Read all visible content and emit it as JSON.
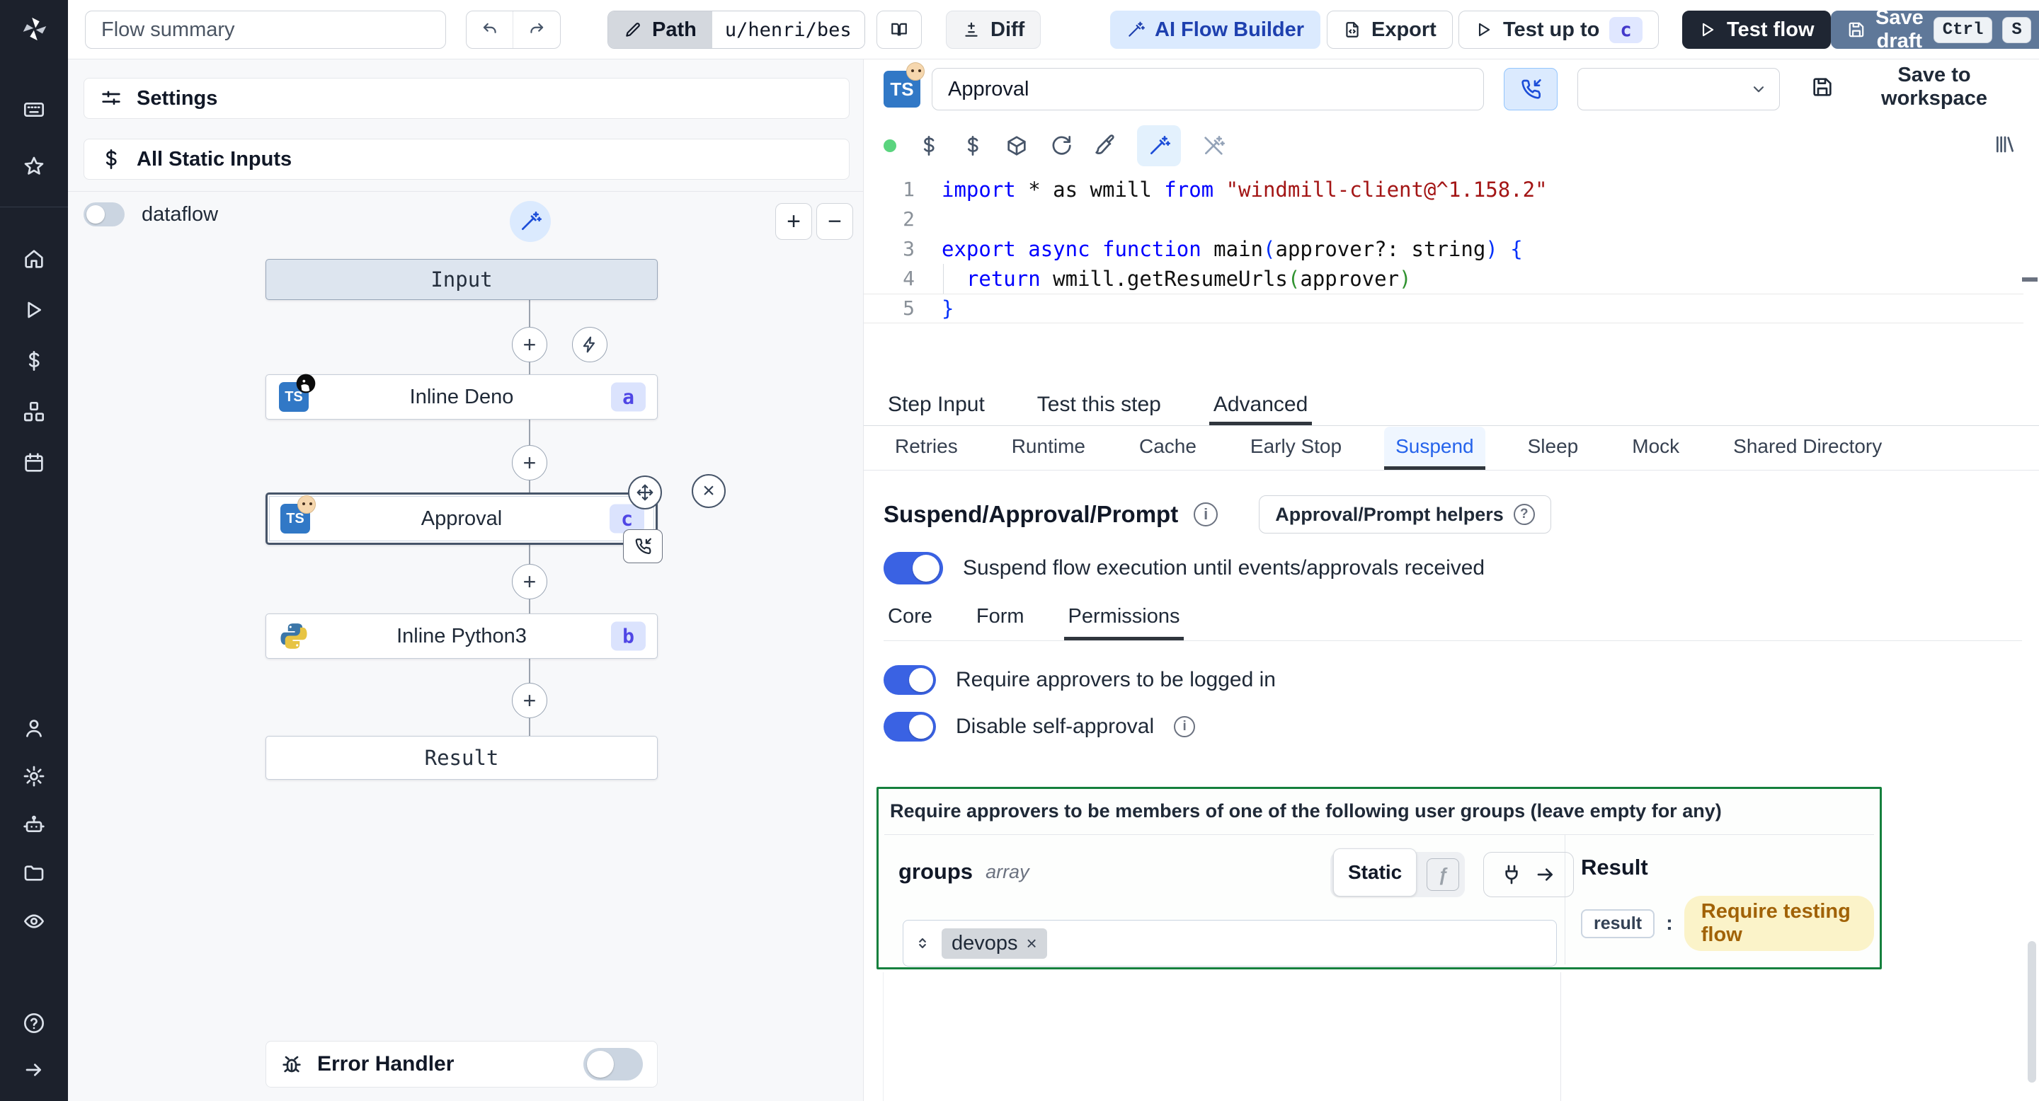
{
  "colors": {
    "toggle_on": "#3a62e3",
    "ai_chip_bg": "#dbeafe",
    "ai_chip_text": "#1e40af",
    "step_badge_bg": "#dbe3fd",
    "step_badge_text": "#4f46e5",
    "green_box_border": "#15803d",
    "result_chip_bg": "#fbf3c9",
    "result_chip_text": "#a16207",
    "test_flow_bg": "#1f2633",
    "save_draft_bg": "#5f7899",
    "keyword_color": "#0000ff",
    "string_color": "#a31515"
  },
  "topbar": {
    "flow_summary_placeholder": "Flow summary",
    "path_label": "Path",
    "path_value": "u/henri/bes",
    "diff_label": "Diff",
    "ai_flow_builder_label": "AI Flow Builder",
    "export_label": "Export",
    "test_up_to_label": "Test up to",
    "test_up_to_badge": "c",
    "test_flow_label": "Test flow",
    "save_draft_label": "Save draft",
    "kbd_ctrl": "Ctrl",
    "kbd_s": "S"
  },
  "flow_panel": {
    "settings_label": "Settings",
    "all_static_inputs_label": "All Static Inputs",
    "dataflow_label": "dataflow",
    "zoom_in": "+",
    "zoom_out": "−",
    "input_node_label": "Input",
    "result_node_label": "Result",
    "steps": [
      {
        "title": "Inline Deno",
        "badge": "a",
        "language": "deno-typescript"
      },
      {
        "title": "Approval",
        "badge": "c",
        "language": "typescript"
      },
      {
        "title": "Inline Python3",
        "badge": "b",
        "language": "python"
      }
    ],
    "error_handler_label": "Error Handler"
  },
  "editor": {
    "language_badge": "TS",
    "step_name": "Approval",
    "save_to_workspace_label": "Save to workspace",
    "line_numbers": [
      "1",
      "2",
      "3",
      "4",
      "5"
    ],
    "code": [
      [
        {
          "t": "import",
          "c": "kw"
        },
        {
          "t": " * as wmill ",
          "c": "pl"
        },
        {
          "t": "from",
          "c": "kw"
        },
        {
          "t": " ",
          "c": "pl"
        },
        {
          "t": "\"windmill-client@^1.158.2\"",
          "c": "str"
        }
      ],
      [],
      [
        {
          "t": "export",
          "c": "kw"
        },
        {
          "t": " ",
          "c": "pl"
        },
        {
          "t": "async",
          "c": "kw"
        },
        {
          "t": " ",
          "c": "pl"
        },
        {
          "t": "function",
          "c": "kw"
        },
        {
          "t": " main",
          "c": "pl"
        },
        {
          "t": "(",
          "c": "b1"
        },
        {
          "t": "approver?: string",
          "c": "pl"
        },
        {
          "t": ")",
          "c": "b1"
        },
        {
          "t": " ",
          "c": "pl"
        },
        {
          "t": "{",
          "c": "b1"
        }
      ],
      [
        {
          "t": "  ",
          "c": "pl"
        },
        {
          "t": "return",
          "c": "kw"
        },
        {
          "t": " wmill.getResumeUrls",
          "c": "pl"
        },
        {
          "t": "(",
          "c": "b2"
        },
        {
          "t": "approver",
          "c": "pl"
        },
        {
          "t": ")",
          "c": "b2"
        }
      ],
      [
        {
          "t": "}",
          "c": "b1"
        }
      ]
    ]
  },
  "tabs": {
    "main": [
      "Step Input",
      "Test this step",
      "Advanced"
    ],
    "active_main": "Advanced",
    "sub": [
      "Retries",
      "Runtime",
      "Cache",
      "Early Stop",
      "Suspend",
      "Sleep",
      "Mock",
      "Shared Directory"
    ],
    "active_sub": "Suspend"
  },
  "suspend": {
    "title": "Suspend/Approval/Prompt",
    "helpers_button_label": "Approval/Prompt helpers",
    "enable_toggle_label": "Suspend flow execution until events/approvals received",
    "subtabs": [
      "Core",
      "Form",
      "Permissions"
    ],
    "active_subtab": "Permissions",
    "require_login_label": "Require approvers to be logged in",
    "disable_self_approval_label": "Disable self-approval",
    "groups_box": {
      "heading": "Require approvers to be members of one of the following user groups (leave empty for any)",
      "field_name": "groups",
      "field_type": "array",
      "static_toggle_label": "Static",
      "function_toggle_label": "ƒ",
      "chips": [
        "devops"
      ],
      "result_title": "Result",
      "result_key": "result",
      "result_separator": ":",
      "result_value": "Require testing flow"
    }
  }
}
